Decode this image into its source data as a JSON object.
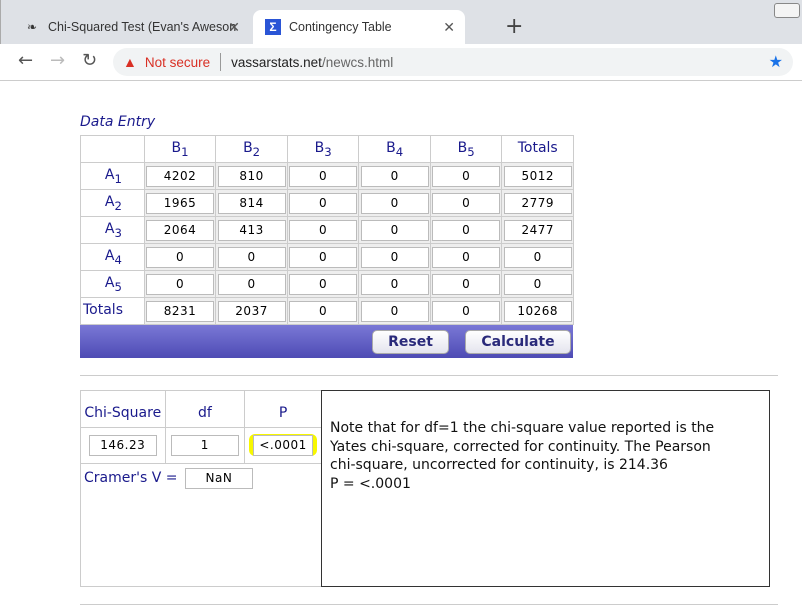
{
  "browser": {
    "tabs": [
      {
        "title": "Chi-Squared Test (Evan's Aweson",
        "icon": "paw-icon"
      },
      {
        "title": "Contingency Table",
        "icon": "sigma-icon",
        "active": true
      }
    ],
    "security_label": "Not secure",
    "url_host": "vassarstats.net",
    "url_path": "/newcs.html"
  },
  "data_entry": {
    "title": "Data Entry",
    "col_headers": [
      "B",
      "B",
      "B",
      "B",
      "B",
      "Totals"
    ],
    "col_subs": [
      "1",
      "2",
      "3",
      "4",
      "5",
      ""
    ],
    "rows": [
      {
        "label": "A",
        "sub": "1",
        "values": [
          "4202",
          "810",
          "0",
          "0",
          "0",
          "5012"
        ]
      },
      {
        "label": "A",
        "sub": "2",
        "values": [
          "1965",
          "814",
          "0",
          "0",
          "0",
          "2779"
        ]
      },
      {
        "label": "A",
        "sub": "3",
        "values": [
          "2064",
          "413",
          "0",
          "0",
          "0",
          "2477"
        ]
      },
      {
        "label": "A",
        "sub": "4",
        "values": [
          "0",
          "0",
          "0",
          "0",
          "0",
          "0"
        ]
      },
      {
        "label": "A",
        "sub": "5",
        "values": [
          "0",
          "0",
          "0",
          "0",
          "0",
          "0"
        ]
      },
      {
        "label": "Totals",
        "sub": "",
        "values": [
          "8231",
          "2037",
          "0",
          "0",
          "0",
          "10268"
        ]
      }
    ],
    "reset_label": "Reset",
    "calculate_label": "Calculate",
    "bar_color": "#5f5cc4"
  },
  "results": {
    "chi_square_label": "Chi-Square",
    "df_label": "df",
    "p_label": "P",
    "chi_square": "146.23",
    "df": "1",
    "p": "<.0001",
    "cramers_label": "Cramer's V =",
    "cramers_v": "NaN",
    "highlight_color": "#f7f700",
    "note": "Note that for df=1 the chi-square value reported is the\nYates chi-square, corrected for continuity. The Pearson\nchi-square, uncorrected for continuity, is 214.36\nP = <.0001"
  }
}
